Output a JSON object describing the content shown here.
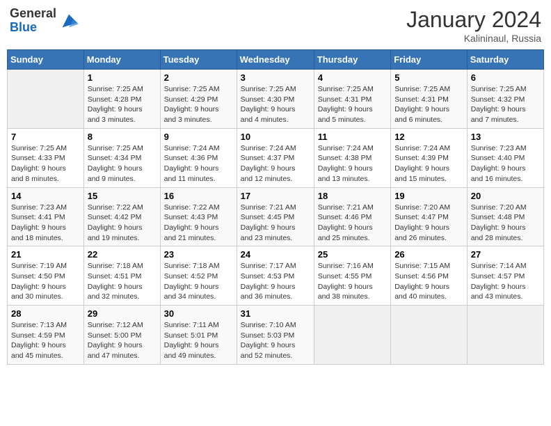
{
  "header": {
    "logo_general": "General",
    "logo_blue": "Blue",
    "month_year": "January 2024",
    "location": "Kalininaul, Russia"
  },
  "columns": [
    "Sunday",
    "Monday",
    "Tuesday",
    "Wednesday",
    "Thursday",
    "Friday",
    "Saturday"
  ],
  "weeks": [
    [
      {
        "day": "",
        "info": ""
      },
      {
        "day": "1",
        "info": "Sunrise: 7:25 AM\nSunset: 4:28 PM\nDaylight: 9 hours\nand 3 minutes."
      },
      {
        "day": "2",
        "info": "Sunrise: 7:25 AM\nSunset: 4:29 PM\nDaylight: 9 hours\nand 3 minutes."
      },
      {
        "day": "3",
        "info": "Sunrise: 7:25 AM\nSunset: 4:30 PM\nDaylight: 9 hours\nand 4 minutes."
      },
      {
        "day": "4",
        "info": "Sunrise: 7:25 AM\nSunset: 4:31 PM\nDaylight: 9 hours\nand 5 minutes."
      },
      {
        "day": "5",
        "info": "Sunrise: 7:25 AM\nSunset: 4:31 PM\nDaylight: 9 hours\nand 6 minutes."
      },
      {
        "day": "6",
        "info": "Sunrise: 7:25 AM\nSunset: 4:32 PM\nDaylight: 9 hours\nand 7 minutes."
      }
    ],
    [
      {
        "day": "7",
        "info": "Sunrise: 7:25 AM\nSunset: 4:33 PM\nDaylight: 9 hours\nand 8 minutes."
      },
      {
        "day": "8",
        "info": "Sunrise: 7:25 AM\nSunset: 4:34 PM\nDaylight: 9 hours\nand 9 minutes."
      },
      {
        "day": "9",
        "info": "Sunrise: 7:24 AM\nSunset: 4:36 PM\nDaylight: 9 hours\nand 11 minutes."
      },
      {
        "day": "10",
        "info": "Sunrise: 7:24 AM\nSunset: 4:37 PM\nDaylight: 9 hours\nand 12 minutes."
      },
      {
        "day": "11",
        "info": "Sunrise: 7:24 AM\nSunset: 4:38 PM\nDaylight: 9 hours\nand 13 minutes."
      },
      {
        "day": "12",
        "info": "Sunrise: 7:24 AM\nSunset: 4:39 PM\nDaylight: 9 hours\nand 15 minutes."
      },
      {
        "day": "13",
        "info": "Sunrise: 7:23 AM\nSunset: 4:40 PM\nDaylight: 9 hours\nand 16 minutes."
      }
    ],
    [
      {
        "day": "14",
        "info": "Sunrise: 7:23 AM\nSunset: 4:41 PM\nDaylight: 9 hours\nand 18 minutes."
      },
      {
        "day": "15",
        "info": "Sunrise: 7:22 AM\nSunset: 4:42 PM\nDaylight: 9 hours\nand 19 minutes."
      },
      {
        "day": "16",
        "info": "Sunrise: 7:22 AM\nSunset: 4:43 PM\nDaylight: 9 hours\nand 21 minutes."
      },
      {
        "day": "17",
        "info": "Sunrise: 7:21 AM\nSunset: 4:45 PM\nDaylight: 9 hours\nand 23 minutes."
      },
      {
        "day": "18",
        "info": "Sunrise: 7:21 AM\nSunset: 4:46 PM\nDaylight: 9 hours\nand 25 minutes."
      },
      {
        "day": "19",
        "info": "Sunrise: 7:20 AM\nSunset: 4:47 PM\nDaylight: 9 hours\nand 26 minutes."
      },
      {
        "day": "20",
        "info": "Sunrise: 7:20 AM\nSunset: 4:48 PM\nDaylight: 9 hours\nand 28 minutes."
      }
    ],
    [
      {
        "day": "21",
        "info": "Sunrise: 7:19 AM\nSunset: 4:50 PM\nDaylight: 9 hours\nand 30 minutes."
      },
      {
        "day": "22",
        "info": "Sunrise: 7:18 AM\nSunset: 4:51 PM\nDaylight: 9 hours\nand 32 minutes."
      },
      {
        "day": "23",
        "info": "Sunrise: 7:18 AM\nSunset: 4:52 PM\nDaylight: 9 hours\nand 34 minutes."
      },
      {
        "day": "24",
        "info": "Sunrise: 7:17 AM\nSunset: 4:53 PM\nDaylight: 9 hours\nand 36 minutes."
      },
      {
        "day": "25",
        "info": "Sunrise: 7:16 AM\nSunset: 4:55 PM\nDaylight: 9 hours\nand 38 minutes."
      },
      {
        "day": "26",
        "info": "Sunrise: 7:15 AM\nSunset: 4:56 PM\nDaylight: 9 hours\nand 40 minutes."
      },
      {
        "day": "27",
        "info": "Sunrise: 7:14 AM\nSunset: 4:57 PM\nDaylight: 9 hours\nand 43 minutes."
      }
    ],
    [
      {
        "day": "28",
        "info": "Sunrise: 7:13 AM\nSunset: 4:59 PM\nDaylight: 9 hours\nand 45 minutes."
      },
      {
        "day": "29",
        "info": "Sunrise: 7:12 AM\nSunset: 5:00 PM\nDaylight: 9 hours\nand 47 minutes."
      },
      {
        "day": "30",
        "info": "Sunrise: 7:11 AM\nSunset: 5:01 PM\nDaylight: 9 hours\nand 49 minutes."
      },
      {
        "day": "31",
        "info": "Sunrise: 7:10 AM\nSunset: 5:03 PM\nDaylight: 9 hours\nand 52 minutes."
      },
      {
        "day": "",
        "info": ""
      },
      {
        "day": "",
        "info": ""
      },
      {
        "day": "",
        "info": ""
      }
    ]
  ]
}
